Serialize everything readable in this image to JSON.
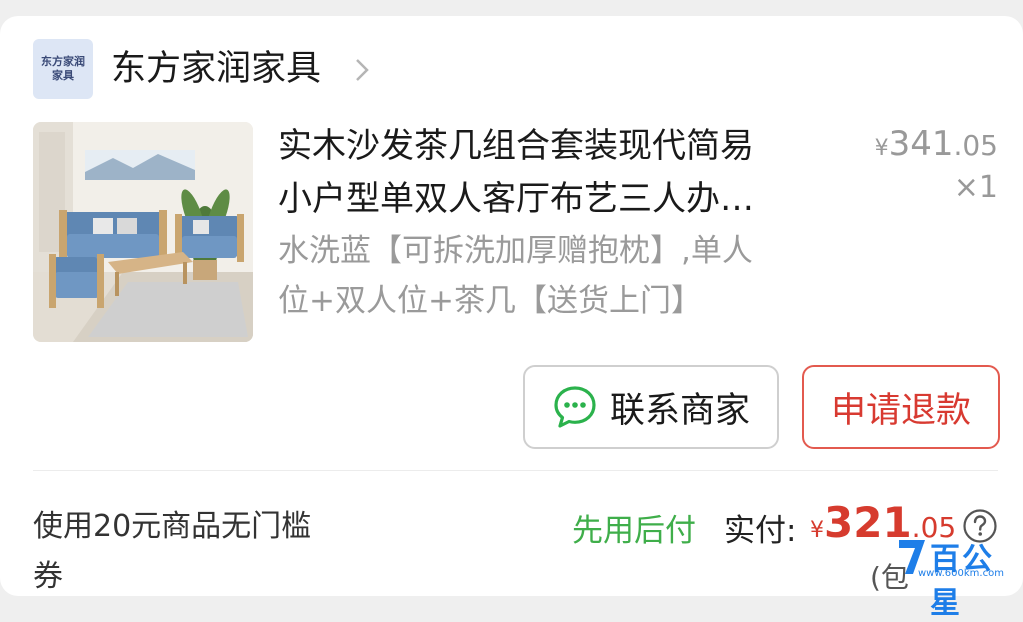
{
  "shop": {
    "logo_line1": "东方家润",
    "logo_line2": "家具",
    "name": "东方家润家具",
    "chevron_icon": "chevron-right-icon"
  },
  "product": {
    "title_line1": "实木沙发茶几组合套装现代简易",
    "title_line2": "小户型单双人客厅布艺三人办…",
    "variant_line1": "水洗蓝【可拆洗加厚赠抱枕】,单人",
    "variant_line2": "位+双人位+茶几【送货上门】",
    "price_currency": "¥",
    "price_int": "341",
    "price_dec": ".05",
    "quantity": "×1",
    "image": "sofa-set-photo"
  },
  "actions": {
    "contact_label": "联系商家",
    "contact_icon": "chat-bubble-icon",
    "refund_label": "申请退款"
  },
  "summary": {
    "coupon_line1": "使用20元商品无门槛",
    "coupon_line2": "券",
    "pay_later": "先用后付",
    "actual_label": "实付:",
    "actual_currency": "¥",
    "actual_int": "321",
    "actual_dec": ".05",
    "bottom_fragment": "(包",
    "help_icon": "question-circle-icon"
  },
  "watermark": {
    "text": "百公星",
    "url": "www.600km.com"
  },
  "colors": {
    "accent_red": "#d83a31",
    "pay_later_green": "#3fae4a",
    "muted_text": "#9a9a9a",
    "watermark_blue": "#1e7ee8"
  }
}
